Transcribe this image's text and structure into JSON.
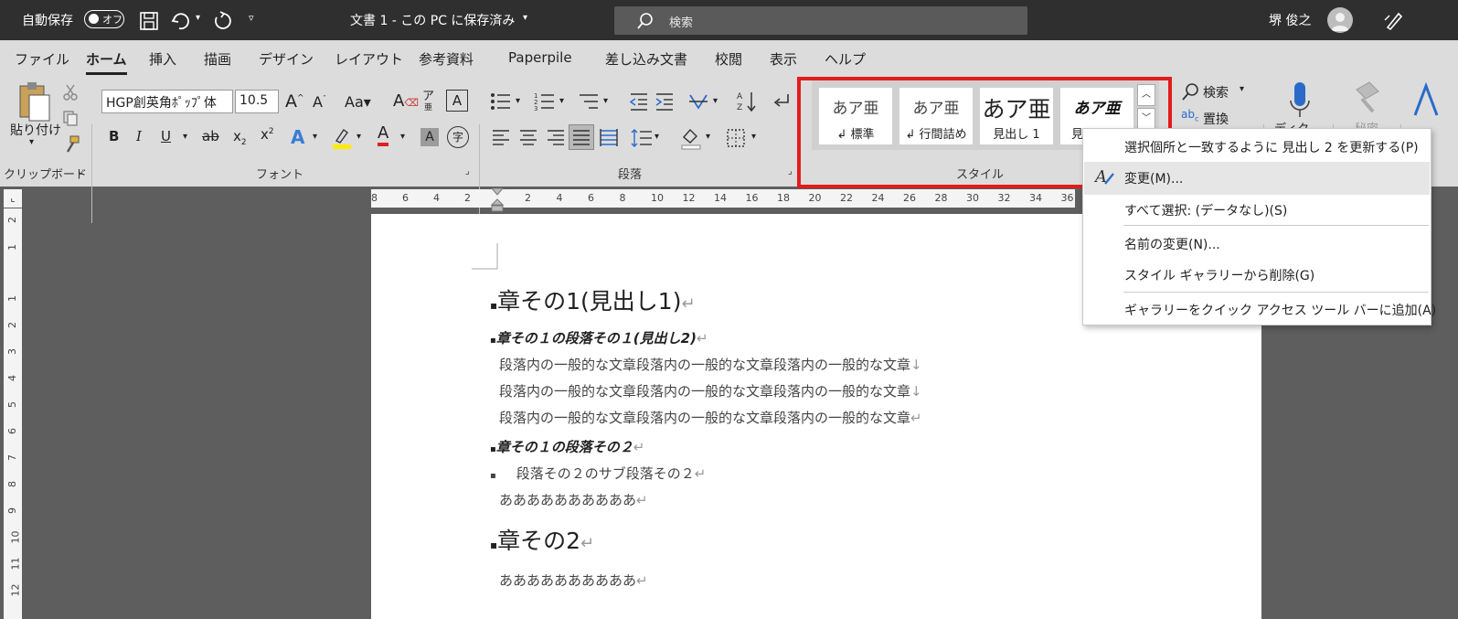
{
  "titlebar": {
    "autosave_label": "自動保存",
    "autosave_state": "オフ",
    "doc_title": "文書 1 - この PC に保存済み",
    "search_placeholder": "検索",
    "user_name": "堺 俊之"
  },
  "tabs": [
    "ファイル",
    "ホーム",
    "挿入",
    "描画",
    "デザイン",
    "レイアウト",
    "参考資料",
    "Paperpile",
    "差し込み文書",
    "校閲",
    "表示",
    "ヘルプ"
  ],
  "ribbon": {
    "paste_label": "貼り付け",
    "font_name": "HGP創英角ﾎﾟｯﾌﾟ体",
    "font_size": "10.5",
    "groups": {
      "clipboard": "クリップボード",
      "font": "フォント",
      "paragraph": "段落",
      "styles": "スタイル"
    },
    "styles": [
      {
        "preview": "あア亜",
        "name": "↲ 標準"
      },
      {
        "preview": "あア亜",
        "name": "↲ 行間詰め"
      },
      {
        "preview": "あア亜",
        "name": "見出し 1"
      },
      {
        "preview": "あア亜",
        "name": "見"
      }
    ],
    "find_label": "検索",
    "replace_label": "置換",
    "dictate_label": "ディク",
    "sensitivity_label": "秘密"
  },
  "ruler_h": [
    "8",
    "6",
    "4",
    "2",
    "2",
    "4",
    "6",
    "8",
    "10",
    "12",
    "14",
    "16",
    "18",
    "20",
    "22",
    "24",
    "26",
    "28",
    "30",
    "32",
    "34",
    "36"
  ],
  "ruler_v": [
    "2",
    "1",
    "1",
    "2",
    "3",
    "4",
    "5",
    "6",
    "7",
    "8",
    "9",
    "10",
    "11",
    "12"
  ],
  "document": {
    "h1_a": "章その1(見出し1)",
    "h2_a": "章その１の段落その１(見出し2)",
    "body_lines": [
      "段落内の一般的な文章段落内の一般的な文章段落内の一般的な文章",
      "段落内の一般的な文章段落内の一般的な文章段落内の一般的な文章",
      "段落内の一般的な文章段落内の一般的な文章段落内の一般的な文章"
    ],
    "h2_b": "章その１の段落その２",
    "sub_para": "段落その２のサブ段落その２",
    "a_line_1": "ああああああああああ",
    "h1_b": "章その2",
    "a_line_2": "ああああああああああ"
  },
  "context_menu": {
    "update": "選択個所と一致するように 見出し 2 を更新する(P)",
    "modify": "変更(M)...",
    "select_all": "すべて選択: (データなし)(S)",
    "rename": "名前の変更(N)...",
    "remove_gallery": "スタイル ギャラリーから削除(G)",
    "add_qat": "ギャラリーをクイック アクセス ツール バーに追加(A)"
  },
  "colors": {
    "annotation_red": "#e21c1c",
    "titlebar": "#2f2f2f",
    "ribbon": "#dcdcdc"
  }
}
